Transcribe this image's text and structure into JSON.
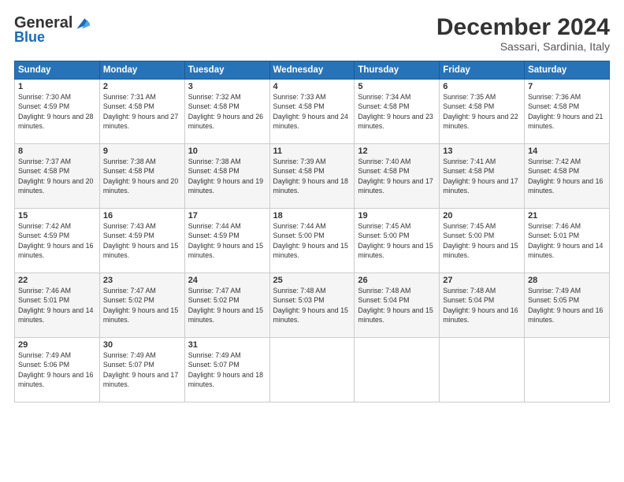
{
  "header": {
    "logo": {
      "general": "General",
      "blue": "Blue"
    },
    "month": "December 2024",
    "location": "Sassari, Sardinia, Italy"
  },
  "weekdays": [
    "Sunday",
    "Monday",
    "Tuesday",
    "Wednesday",
    "Thursday",
    "Friday",
    "Saturday"
  ],
  "weeks": [
    [
      {
        "day": "1",
        "sunrise": "7:30 AM",
        "sunset": "4:59 PM",
        "daylight": "9 hours and 28 minutes."
      },
      {
        "day": "2",
        "sunrise": "7:31 AM",
        "sunset": "4:58 PM",
        "daylight": "9 hours and 27 minutes."
      },
      {
        "day": "3",
        "sunrise": "7:32 AM",
        "sunset": "4:58 PM",
        "daylight": "9 hours and 26 minutes."
      },
      {
        "day": "4",
        "sunrise": "7:33 AM",
        "sunset": "4:58 PM",
        "daylight": "9 hours and 24 minutes."
      },
      {
        "day": "5",
        "sunrise": "7:34 AM",
        "sunset": "4:58 PM",
        "daylight": "9 hours and 23 minutes."
      },
      {
        "day": "6",
        "sunrise": "7:35 AM",
        "sunset": "4:58 PM",
        "daylight": "9 hours and 22 minutes."
      },
      {
        "day": "7",
        "sunrise": "7:36 AM",
        "sunset": "4:58 PM",
        "daylight": "9 hours and 21 minutes."
      }
    ],
    [
      {
        "day": "8",
        "sunrise": "7:37 AM",
        "sunset": "4:58 PM",
        "daylight": "9 hours and 20 minutes."
      },
      {
        "day": "9",
        "sunrise": "7:38 AM",
        "sunset": "4:58 PM",
        "daylight": "9 hours and 20 minutes."
      },
      {
        "day": "10",
        "sunrise": "7:38 AM",
        "sunset": "4:58 PM",
        "daylight": "9 hours and 19 minutes."
      },
      {
        "day": "11",
        "sunrise": "7:39 AM",
        "sunset": "4:58 PM",
        "daylight": "9 hours and 18 minutes."
      },
      {
        "day": "12",
        "sunrise": "7:40 AM",
        "sunset": "4:58 PM",
        "daylight": "9 hours and 17 minutes."
      },
      {
        "day": "13",
        "sunrise": "7:41 AM",
        "sunset": "4:58 PM",
        "daylight": "9 hours and 17 minutes."
      },
      {
        "day": "14",
        "sunrise": "7:42 AM",
        "sunset": "4:58 PM",
        "daylight": "9 hours and 16 minutes."
      }
    ],
    [
      {
        "day": "15",
        "sunrise": "7:42 AM",
        "sunset": "4:59 PM",
        "daylight": "9 hours and 16 minutes."
      },
      {
        "day": "16",
        "sunrise": "7:43 AM",
        "sunset": "4:59 PM",
        "daylight": "9 hours and 15 minutes."
      },
      {
        "day": "17",
        "sunrise": "7:44 AM",
        "sunset": "4:59 PM",
        "daylight": "9 hours and 15 minutes."
      },
      {
        "day": "18",
        "sunrise": "7:44 AM",
        "sunset": "5:00 PM",
        "daylight": "9 hours and 15 minutes."
      },
      {
        "day": "19",
        "sunrise": "7:45 AM",
        "sunset": "5:00 PM",
        "daylight": "9 hours and 15 minutes."
      },
      {
        "day": "20",
        "sunrise": "7:45 AM",
        "sunset": "5:00 PM",
        "daylight": "9 hours and 15 minutes."
      },
      {
        "day": "21",
        "sunrise": "7:46 AM",
        "sunset": "5:01 PM",
        "daylight": "9 hours and 14 minutes."
      }
    ],
    [
      {
        "day": "22",
        "sunrise": "7:46 AM",
        "sunset": "5:01 PM",
        "daylight": "9 hours and 14 minutes."
      },
      {
        "day": "23",
        "sunrise": "7:47 AM",
        "sunset": "5:02 PM",
        "daylight": "9 hours and 15 minutes."
      },
      {
        "day": "24",
        "sunrise": "7:47 AM",
        "sunset": "5:02 PM",
        "daylight": "9 hours and 15 minutes."
      },
      {
        "day": "25",
        "sunrise": "7:48 AM",
        "sunset": "5:03 PM",
        "daylight": "9 hours and 15 minutes."
      },
      {
        "day": "26",
        "sunrise": "7:48 AM",
        "sunset": "5:04 PM",
        "daylight": "9 hours and 15 minutes."
      },
      {
        "day": "27",
        "sunrise": "7:48 AM",
        "sunset": "5:04 PM",
        "daylight": "9 hours and 16 minutes."
      },
      {
        "day": "28",
        "sunrise": "7:49 AM",
        "sunset": "5:05 PM",
        "daylight": "9 hours and 16 minutes."
      }
    ],
    [
      {
        "day": "29",
        "sunrise": "7:49 AM",
        "sunset": "5:06 PM",
        "daylight": "9 hours and 16 minutes."
      },
      {
        "day": "30",
        "sunrise": "7:49 AM",
        "sunset": "5:07 PM",
        "daylight": "9 hours and 17 minutes."
      },
      {
        "day": "31",
        "sunrise": "7:49 AM",
        "sunset": "5:07 PM",
        "daylight": "9 hours and 18 minutes."
      },
      null,
      null,
      null,
      null
    ]
  ]
}
